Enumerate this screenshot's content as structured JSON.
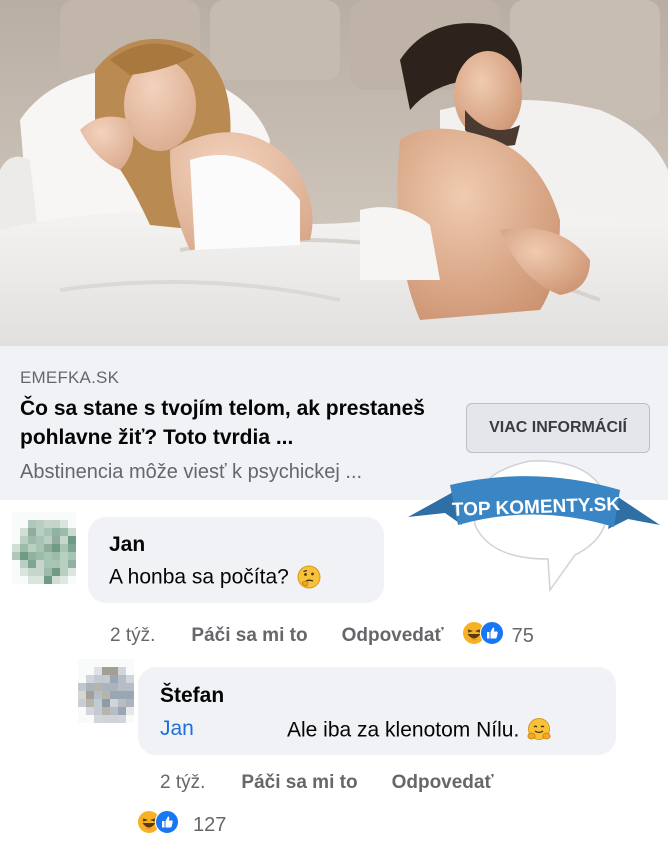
{
  "link_preview": {
    "domain": "EMEFKA.SK",
    "headline": "Čo sa stane s tvojím telom, ak prestaneš pohlavne žiť? Toto tvrdia ...",
    "subtitle": "Abstinencia môže viesť k psychickej ...",
    "cta_label": "VIAC INFORMÁCIÍ"
  },
  "badge": {
    "text": "TOP KOMENTY.SK",
    "color": "#3a86c4"
  },
  "comments": [
    {
      "author": "Jan",
      "text": "A honba sa počíta?",
      "text_emoji": "thinking-face-icon",
      "time": "2 týž.",
      "like_label": "Páči sa mi to",
      "reply_label": "Odpovedať",
      "reaction_icons": [
        "haha-icon",
        "like-icon"
      ],
      "reaction_count": "75"
    },
    {
      "author": "Štefan",
      "mention": "Jan",
      "text": "Ale iba za klenotom Nílu.",
      "text_emoji": "hugging-face-icon",
      "time": "2 týž.",
      "like_label": "Páči sa mi to",
      "reply_label": "Odpovedať",
      "reaction_icons": [
        "haha-icon",
        "like-icon"
      ],
      "reaction_count": "127"
    }
  ],
  "colors": {
    "link_blue": "#216fdb",
    "bubble_bg": "#f0f2f5",
    "secondary_text": "#65676b",
    "like_blue": "#1877f2",
    "haha_yellow": "#f7b125"
  }
}
